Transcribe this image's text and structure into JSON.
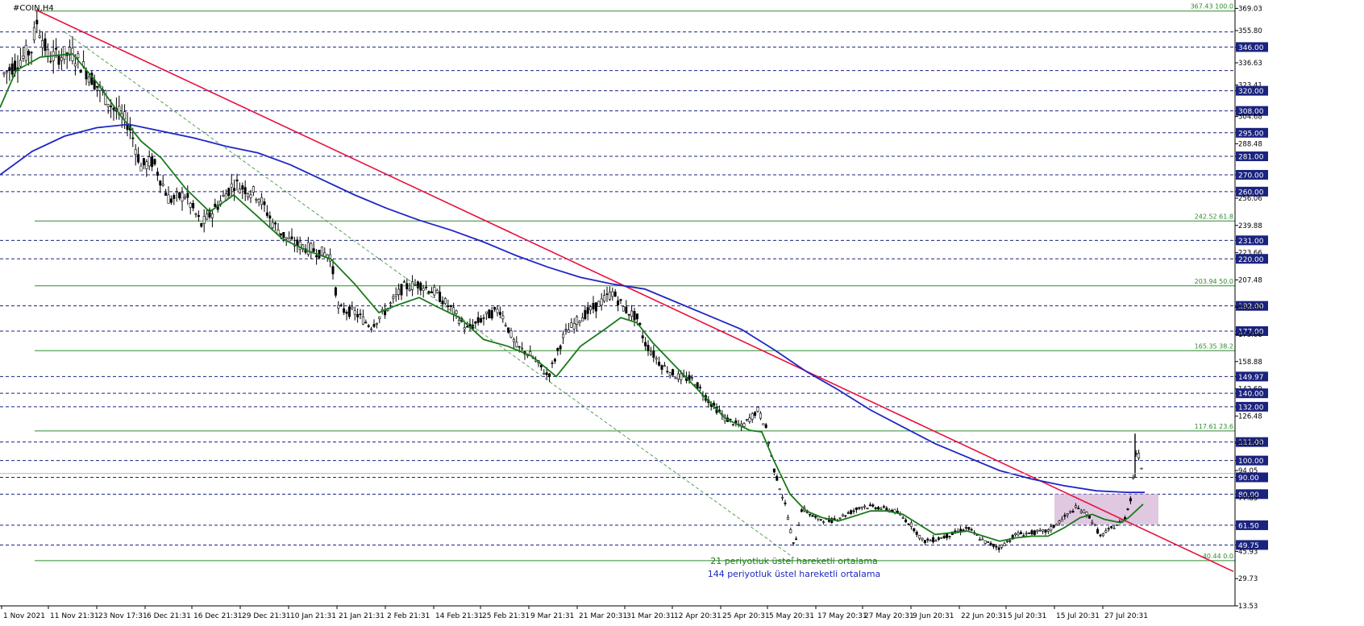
{
  "title": "#COIN,H4",
  "colors": {
    "background": "#ffffff",
    "axis": "#000000",
    "candle": "#000000",
    "ema21": "#1a7a1a",
    "ema144": "#1f26c4",
    "trendline": "#e8103c",
    "fib": "#2e8b2e",
    "level": "#1a237e",
    "zone": "#d6b6d6",
    "price_tag_bg": "#1a237e",
    "price_tag_text": "#ffffff"
  },
  "chart_data": {
    "type": "candlestick",
    "symbol": "#COIN",
    "timeframe": "H4",
    "ylim": [
      13.53,
      374.0
    ],
    "y_ticks": [
      "369.03",
      "355.80",
      "346.00",
      "336.63",
      "323.41",
      "320.00",
      "308.00",
      "304.68",
      "295.00",
      "288.48",
      "281.00",
      "270.00",
      "260.00",
      "256.06",
      "239.88",
      "231.00",
      "223.66",
      "220.00",
      "207.48",
      "192.00",
      "191.30",
      "177.00",
      "175.08",
      "158.88",
      "149.97",
      "142.69",
      "140.00",
      "132.00",
      "126.48",
      "111.00",
      "110.28",
      "100.00",
      "94.05",
      "90.00",
      "80.00",
      "77.85",
      "61.50",
      "49.75",
      "45.93",
      "29.73",
      "13.53"
    ],
    "x_ticks": [
      "1 Nov 2021",
      "11 Nov 21:31",
      "23 Nov 17:31",
      "6 Dec 21:31",
      "16 Dec 21:31",
      "29 Dec 21:31",
      "10 Jan 21:31",
      "21 Jan 21:31",
      "2 Feb 21:31",
      "14 Feb 21:31",
      "25 Feb 21:31",
      "9 Mar 21:31",
      "21 Mar 20:31",
      "31 Mar 20:31",
      "12 Apr 20:31",
      "25 Apr 20:31",
      "5 May 20:31",
      "17 May 20:31",
      "27 May 20:31",
      "9 Jun 20:31",
      "22 Jun 20:31",
      "5 Jul 20:31",
      "15 Jul 20:31",
      "27 Jul 20:31"
    ],
    "horizontal_levels": [
      "355.00",
      "346.00",
      "332.00",
      "320.00",
      "308.00",
      "295.00",
      "281.00",
      "270.00",
      "260.00",
      "231.00",
      "220.00",
      "192.00",
      "177.00",
      "149.97",
      "140.00",
      "132.00",
      "111.00",
      "100.00",
      "90.00",
      "80.00",
      "61.50",
      "49.75"
    ],
    "fibonacci": [
      {
        "label": "367.43 100.0",
        "price": 367.43
      },
      {
        "label": "242.52 61.8",
        "price": 242.52
      },
      {
        "label": "203.94 50.0",
        "price": 203.94
      },
      {
        "label": "165.35 38.2",
        "price": 165.35
      },
      {
        "label": "117.61 23.6",
        "price": 117.61
      },
      {
        "label": "40.44 0.0",
        "price": 40.44
      }
    ],
    "current_price": 92.3,
    "series": [
      {
        "name": "21 periyotluk üstel hareketli ortalama",
        "type": "line",
        "color": "#1a7a1a",
        "points": [
          [
            0,
            310
          ],
          [
            20,
            332
          ],
          [
            50,
            340
          ],
          [
            90,
            342
          ],
          [
            120,
            325
          ],
          [
            150,
            305
          ],
          [
            175,
            290
          ],
          [
            200,
            280
          ],
          [
            230,
            262
          ],
          [
            260,
            248
          ],
          [
            290,
            258
          ],
          [
            320,
            245
          ],
          [
            350,
            232
          ],
          [
            380,
            225
          ],
          [
            410,
            220
          ],
          [
            440,
            205
          ],
          [
            470,
            188
          ],
          [
            490,
            192
          ],
          [
            520,
            197
          ],
          [
            540,
            192
          ],
          [
            570,
            185
          ],
          [
            600,
            172
          ],
          [
            630,
            168
          ],
          [
            660,
            162
          ],
          [
            690,
            150
          ],
          [
            720,
            168
          ],
          [
            750,
            178
          ],
          [
            770,
            185
          ],
          [
            790,
            182
          ],
          [
            810,
            170
          ],
          [
            840,
            155
          ],
          [
            870,
            140
          ],
          [
            900,
            125
          ],
          [
            930,
            118
          ],
          [
            945,
            117
          ],
          [
            960,
            100
          ],
          [
            980,
            80
          ],
          [
            1000,
            70
          ],
          [
            1020,
            66
          ],
          [
            1040,
            64
          ],
          [
            1060,
            67
          ],
          [
            1080,
            70
          ],
          [
            1100,
            70
          ],
          [
            1120,
            68
          ],
          [
            1140,
            62
          ],
          [
            1160,
            56
          ],
          [
            1180,
            57
          ],
          [
            1200,
            58
          ],
          [
            1220,
            55
          ],
          [
            1240,
            52
          ],
          [
            1260,
            54
          ],
          [
            1280,
            55
          ],
          [
            1300,
            55
          ],
          [
            1320,
            60
          ],
          [
            1340,
            66
          ],
          [
            1355,
            68
          ],
          [
            1370,
            65
          ],
          [
            1390,
            63
          ],
          [
            1400,
            66
          ],
          [
            1418,
            74
          ]
        ]
      },
      {
        "name": "144 periyotluk üstel hareketli ortalama",
        "type": "line",
        "color": "#1f26c4",
        "points": [
          [
            0,
            270
          ],
          [
            40,
            284
          ],
          [
            80,
            293
          ],
          [
            120,
            298
          ],
          [
            160,
            300
          ],
          [
            200,
            296
          ],
          [
            240,
            292
          ],
          [
            280,
            287
          ],
          [
            320,
            283
          ],
          [
            360,
            276
          ],
          [
            400,
            267
          ],
          [
            440,
            258
          ],
          [
            480,
            250
          ],
          [
            520,
            243
          ],
          [
            560,
            237
          ],
          [
            600,
            230
          ],
          [
            640,
            222
          ],
          [
            680,
            215
          ],
          [
            720,
            209
          ],
          [
            760,
            205
          ],
          [
            800,
            202
          ],
          [
            840,
            194
          ],
          [
            880,
            186
          ],
          [
            920,
            178
          ],
          [
            960,
            166
          ],
          [
            1000,
            153
          ],
          [
            1040,
            142
          ],
          [
            1080,
            130
          ],
          [
            1120,
            120
          ],
          [
            1160,
            110
          ],
          [
            1200,
            102
          ],
          [
            1240,
            94
          ],
          [
            1280,
            89
          ],
          [
            1320,
            85
          ],
          [
            1360,
            82
          ],
          [
            1400,
            81
          ],
          [
            1420,
            81
          ]
        ]
      }
    ],
    "trendline": {
      "from": [
        45,
        368
      ],
      "to": [
        1530,
        34
      ]
    },
    "trendline_dashed": {
      "from": [
        80,
        355
      ],
      "to": [
        985,
        42
      ]
    },
    "zone": {
      "x0": 1308,
      "x1": 1437,
      "y_top": 80.0,
      "y_bottom": 62.0
    },
    "candles_summary": "High 367.43 (early Nov 2021), low 40.44 (May 2022), last ~92"
  },
  "legend": {
    "ema21_label": "21 periyotluk üstel hareketli ortalama",
    "ema144_label": "144 periyotluk üstel hareketli ortalama"
  }
}
